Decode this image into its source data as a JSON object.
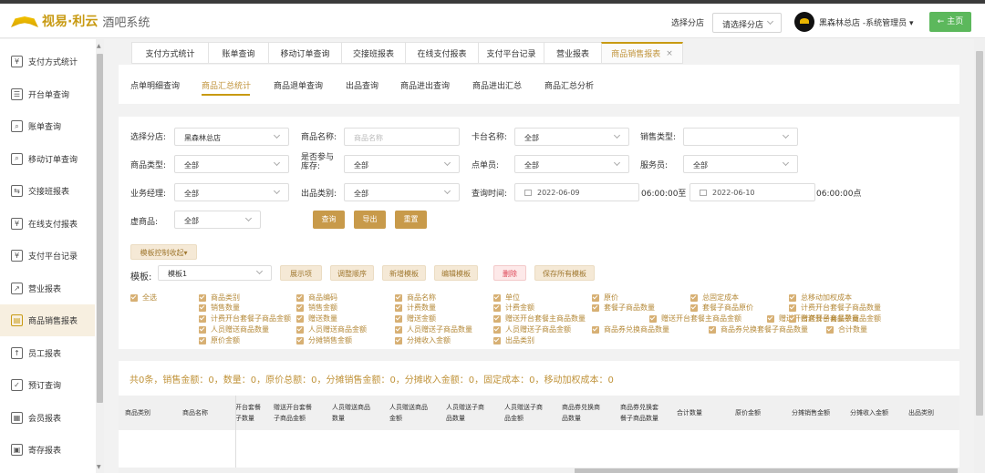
{
  "header": {
    "logo_text": "视易·利云",
    "logo_sub": "酒吧系统",
    "branch_label": "选择分店",
    "branch_placeholder": "请选择分店",
    "user": "黑森林总店 -系统管理员 ▾",
    "home_button": "← 主页"
  },
  "sidebar": {
    "items": [
      {
        "label": "支付方式统计",
        "icon": "payment-icon"
      },
      {
        "label": "开台单查询",
        "icon": "document-icon"
      },
      {
        "label": "账单查询",
        "icon": "bill-search-icon"
      },
      {
        "label": "移动订单查询",
        "icon": "mobile-order-icon"
      },
      {
        "label": "交接班报表",
        "icon": "shift-icon"
      },
      {
        "label": "在线支付报表",
        "icon": "online-pay-icon"
      },
      {
        "label": "支付平台记录",
        "icon": "platform-icon"
      },
      {
        "label": "营业报表",
        "icon": "business-icon"
      },
      {
        "label": "商品销售报表",
        "icon": "sales-icon"
      },
      {
        "label": "员工报表",
        "icon": "staff-icon"
      },
      {
        "label": "预订查询",
        "icon": "booking-icon"
      },
      {
        "label": "会员报表",
        "icon": "member-icon"
      },
      {
        "label": "寄存报表",
        "icon": "storage-icon"
      }
    ]
  },
  "tabs": [
    "支付方式统计",
    "账单查询",
    "移动订单查询",
    "交接班报表",
    "在线支付报表",
    "支付平台记录",
    "营业报表",
    "商品销售报表"
  ],
  "tab_close": "×",
  "subnav": [
    "点单明细查询",
    "商品汇总统计",
    "商品退单查询",
    "出品查询",
    "商品进出查询",
    "商品进出汇总",
    "商品汇总分析"
  ],
  "filters": {
    "branch_label": "选择分店:",
    "branch_value": "黑森林总店",
    "product_name_label": "商品名称:",
    "product_name_placeholder": "商品名称",
    "table_name_label": "卡台名称:",
    "table_name_value": "全部",
    "sale_type_label": "销售类型:",
    "sale_type_value": "",
    "product_type_label": "商品类型:",
    "product_type_value": "全部",
    "stock_label_1": "是否参与",
    "stock_label_2": "库存:",
    "stock_value": "全部",
    "orderer_label": "点单员:",
    "orderer_value": "全部",
    "waiter_label": "服务员:",
    "waiter_value": "全部",
    "manager_label": "业务经理:",
    "manager_value": "全部",
    "output_label": "出品类别:",
    "output_value": "全部",
    "time_label": "查询时间:",
    "date_from": "2022-06-09",
    "time_from": "06:00:00至",
    "date_to": "2022-06-10",
    "time_to": "06:00:00点",
    "virtual_label": "虚商品:",
    "virtual_value": "全部",
    "query_btn": "查询",
    "export_btn": "导出",
    "reset_btn": "重置",
    "template_toggle": "模板控制收起▾",
    "template_label": "模板:",
    "template_value": "模板1",
    "tpl_buttons": [
      "展示项",
      "调整顺序",
      "新增模板",
      "编辑模板"
    ],
    "tpl_delete": "删除",
    "tpl_save": "保存所有模板"
  },
  "checkboxes": [
    "全选",
    "商品类别",
    "商品编码",
    "商品名称",
    "单位",
    "原价",
    "总固定成本",
    "总移动加权成本",
    "销售数量",
    "销售金额",
    "计费数量",
    "计费金额",
    "套餐子商品数量",
    "套餐子商品原价",
    "计费开台套餐子商品数量",
    "计费开台套餐子商品金额",
    "赠送数量",
    "赠送金额",
    "赠送开台套餐主商品数量",
    "赠送开台套餐主商品金额",
    "赠送开台套餐子商品数量",
    "赠送开台套餐子商品金额",
    "人员赠送商品数量",
    "人员赠送商品金额",
    "人员赠送子商品数量",
    "人员赠送子商品金额",
    "商品券兑换商品数量",
    "商品券兑换套餐子商品数量",
    "合计数量",
    "原价金额",
    "分摊销售金额",
    "分摊收入金额",
    "出品类别"
  ],
  "summary": "共0条，销售金额：0，数量：0，原价总额：0，分摊销售金额：0，分摊收入金额：0，固定成本：0，移动加权成本：0",
  "table_headers": [
    [
      "商品类别"
    ],
    [
      "商品名称"
    ],
    [
      "开台套餐",
      "子数量"
    ],
    [
      "赠送开台套餐",
      "子商品金额"
    ],
    [
      "人员赠送商品",
      "数量"
    ],
    [
      "人员赠送商品",
      "金额"
    ],
    [
      "人员赠送子商",
      "品数量"
    ],
    [
      "人员赠送子商",
      "品金额"
    ],
    [
      "商品券兑换商",
      "品数量"
    ],
    [
      "商品券兑换套",
      "餐子商品数量"
    ],
    [
      "合计数量"
    ],
    [
      "原价金额"
    ],
    [
      "分摊销售金额"
    ],
    [
      "分摊收入金额"
    ],
    [
      "出品类别"
    ]
  ]
}
